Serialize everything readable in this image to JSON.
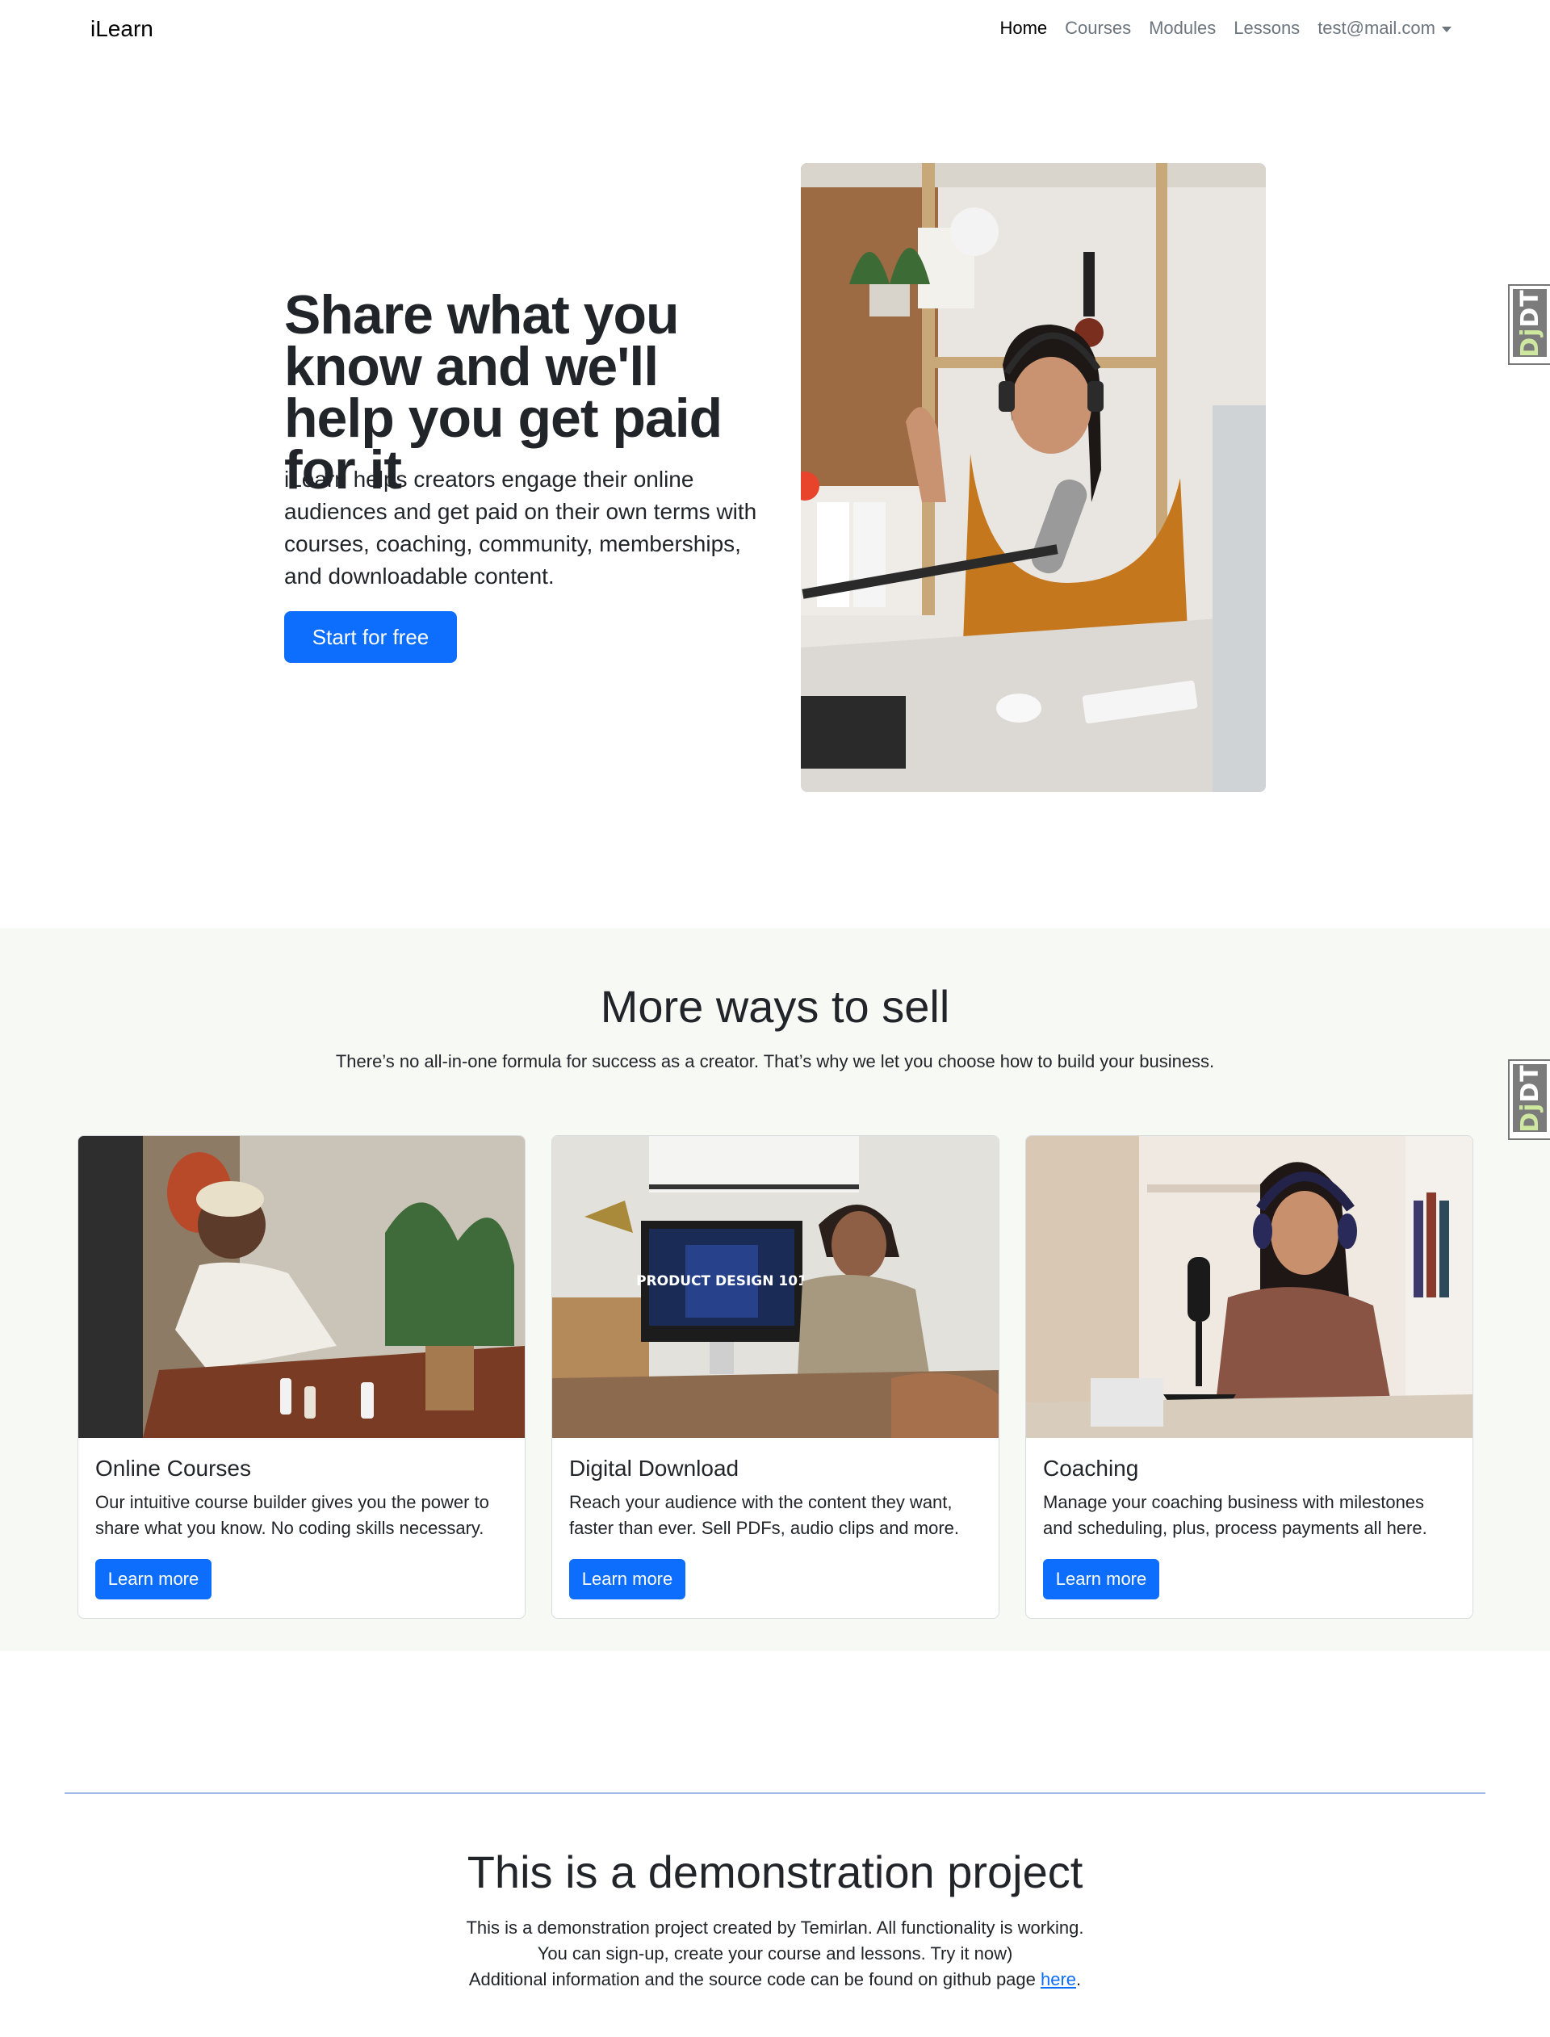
{
  "navbar": {
    "brand": "iLearn",
    "links": [
      "Home",
      "Courses",
      "Modules",
      "Lessons"
    ],
    "user_email": "test@mail.com"
  },
  "hero": {
    "title": "Share what you know and we'll help you get paid for it",
    "lead": "iLearn helps creators engage their online audiences and get paid on their own terms with courses, coaching, community, memberships, and downloadable content.",
    "cta": "Start for free"
  },
  "debug_toolbar": {
    "label_a": "Dj",
    "label_b": "DT"
  },
  "ways": {
    "title": "More ways to sell",
    "subtitle": "There’s no all-in-one formula for success as a creator. That’s why we let you choose how to build your business.",
    "cards": [
      {
        "title": "Online Courses",
        "text": "Our intuitive course builder gives you the power to share what you know. No coding skills necessary.",
        "button": "Learn more"
      },
      {
        "title": "Digital Download",
        "text": "Reach your audience with the content they want, faster than ever. Sell PDFs, audio clips and more.",
        "button": "Learn more"
      },
      {
        "title": "Coaching",
        "text": "Manage your coaching business with milestones and scheduling, plus, process payments all here.",
        "button": "Learn more"
      }
    ],
    "monitor_text": "PRODUCT DESIGN 101"
  },
  "demo": {
    "title": "This is a demonstration project",
    "line1": "This is a demonstration project created by Temirlan. All functionality is working.",
    "line2": "You can sign-up, create your course and lessons. Try it now)",
    "line3_prefix": "Additional information and the source code can be found on github page ",
    "link_text": "here",
    "line3_suffix": "."
  },
  "colors": {
    "primary": "#0d6efd",
    "section_bg": "#f7f9f5",
    "text": "#212529",
    "muted": "#6c757d"
  }
}
